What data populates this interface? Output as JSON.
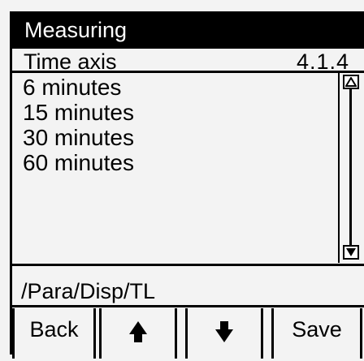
{
  "title": "Measuring",
  "header": {
    "label": "Time axis",
    "code": "4.1.4"
  },
  "list": {
    "items": [
      {
        "label": "6 minutes"
      },
      {
        "label": "15 minutes"
      },
      {
        "label": "30 minutes"
      },
      {
        "label": "60 minutes"
      }
    ]
  },
  "path": "/Para/Disp/TL",
  "buttons": {
    "back": "Back",
    "up_icon": "arrow-up-icon",
    "down_icon": "arrow-down-icon",
    "save": "Save"
  }
}
